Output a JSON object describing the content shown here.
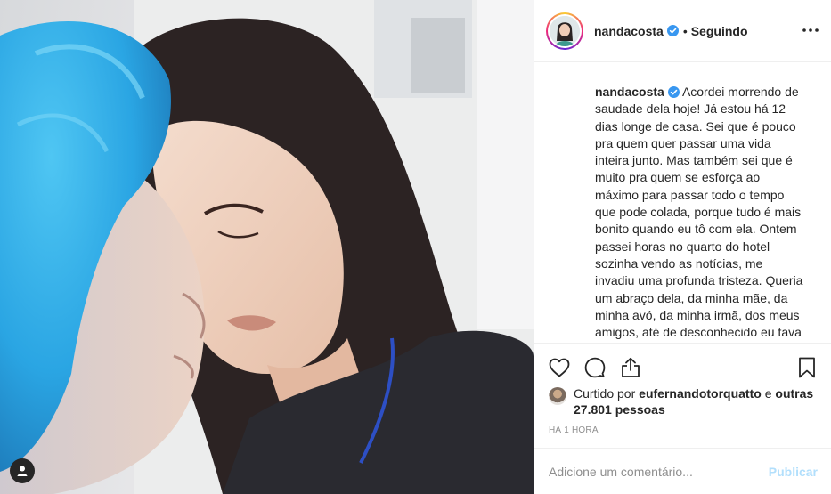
{
  "post": {
    "author": {
      "username": "nandacosta",
      "verified": true,
      "avatar_icon": "profile-photo",
      "follow_state": "Seguindo"
    },
    "header_menu_icon": "more-horizontal-icon",
    "photo": {
      "description_icon": "photo-two-people",
      "user_tag_icon": "user-tag-icon"
    },
    "caption": {
      "username": "nandacosta",
      "text": "Acordei morrendo de saudade dela hoje! Já estou há 12 dias longe de casa. Sei que é pouco pra quem quer passar uma vida inteira junto. Mas também sei que é muito pra quem se esforça ao máximo para passar todo o tempo que pode colada, porque tudo é mais bonito quando eu tô com ela. Ontem passei horas no quarto do hotel sozinha vendo as notícias, me invadiu uma profunda tristeza. Queria um abraço dela, da minha mãe, da minha avó, da minha irmã, dos meus amigos, até de desconhecido eu tava querendo um abraço. Estamos precisando de amor,"
    },
    "actions": {
      "like_icon": "heart-icon",
      "comment_icon": "comment-icon",
      "share_icon": "share-icon",
      "save_icon": "bookmark-icon"
    },
    "likes": {
      "prefix": "Curtido por",
      "liked_by": "eufernandotorquatto",
      "connector": "e",
      "others": "outras 27.801 pessoas"
    },
    "timestamp": "Há 1 hora",
    "comment": {
      "placeholder": "Adicione um comentário...",
      "publish_label": "Publicar"
    },
    "colors": {
      "text": "#262626",
      "muted": "#8e8e8e",
      "verified_blue": "#3897f0",
      "publish_disabled": "#b2dffc",
      "divider": "#efefef"
    }
  }
}
